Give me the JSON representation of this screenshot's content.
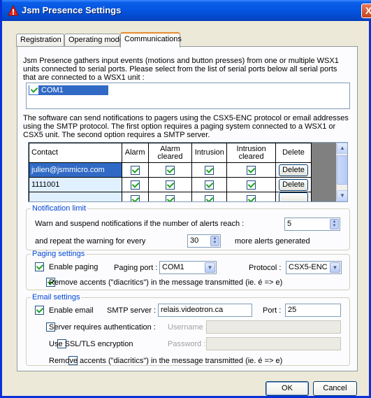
{
  "window": {
    "title": "Jsm Presence Settings",
    "close_label": "X"
  },
  "tabs": [
    {
      "label": "Registration"
    },
    {
      "label": "Operating mode"
    },
    {
      "label": "Communications"
    }
  ],
  "intro_text": "Jsm Presence gathers input events (motions and button presses) from one or multiple WSX1 units connected to serial ports. Please select from the list of serial ports below all serial ports that are connected to a WSX1 unit :",
  "serial_ports": [
    {
      "label": "COM1",
      "checked": true
    }
  ],
  "notification_text": "The software can send notifications to pagers using the CSX5-ENC  protocol or email addresses using the SMTP protocol. The first option requires a paging system connected to a WSX1 or CSX5  unit. The second option requires a SMTP server.",
  "contacts_table": {
    "headers": [
      "Contact",
      "Alarm",
      "Alarm cleared",
      "Intrusion",
      "Intrusion cleared",
      "Delete"
    ],
    "rows": [
      {
        "contact": "julien@jsmmicro.com",
        "alarm": true,
        "alarm_cleared": true,
        "intrusion": true,
        "intrusion_cleared": true,
        "delete_label": "Delete"
      },
      {
        "contact": "1111001",
        "alarm": true,
        "alarm_cleared": true,
        "intrusion": true,
        "intrusion_cleared": true,
        "delete_label": "Delete"
      },
      {
        "contact": "",
        "alarm": true,
        "alarm_cleared": true,
        "intrusion": true,
        "intrusion_cleared": true,
        "delete_label": ""
      }
    ]
  },
  "notification_limit": {
    "title": "Notification limit",
    "warn_label": "Warn and suspend notifications if the number of alerts reach :",
    "warn_value": "5",
    "repeat_label": "and repeat the warning for every",
    "repeat_value": "30",
    "repeat_suffix": "more alerts generated"
  },
  "paging": {
    "title": "Paging settings",
    "enable_label": "Enable paging",
    "enable_checked": true,
    "port_label": "Paging port :",
    "port_value": "COM1",
    "protocol_label": "Protocol :",
    "protocol_value": "CSX5-ENC",
    "remove_accents_label": "Remove accents (\"diacritics\") in the message transmitted (ie. é => e)",
    "remove_accents_checked": true
  },
  "email": {
    "title": "Email settings",
    "enable_label": "Enable email",
    "enable_checked": true,
    "smtp_label": "SMTP server :",
    "smtp_value": "relais.videotron.ca",
    "port_label": "Port :",
    "port_value": "25",
    "auth_label": "Server requires authentication :",
    "auth_checked": false,
    "username_label": "Username :",
    "ssl_label": "Use SSL/TLS encryption",
    "ssl_checked": false,
    "password_label": "Password :",
    "remove_accents_label": "Remove accents (\"diacritics\") in the message transmitted (ie. é => e)",
    "remove_accents_checked": false
  },
  "buttons": {
    "ok_label": "OK",
    "cancel_label": "Cancel"
  },
  "colors": {
    "title_bar": "#0555e0",
    "group_title": "#0046d5",
    "selection": "#316ac5",
    "check": "#21a121"
  }
}
